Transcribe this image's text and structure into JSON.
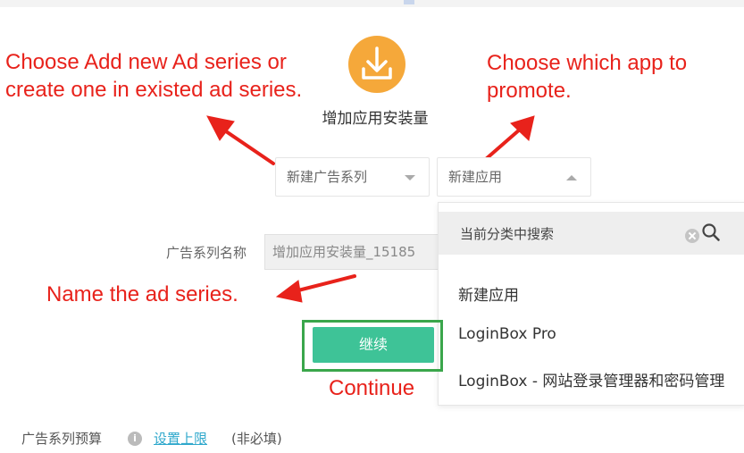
{
  "header": {
    "goal_title": "增加应用安装量",
    "icon": "download-icon",
    "icon_color": "#f5a83a"
  },
  "ad_series_select": {
    "value": "新建广告系列",
    "caret": "chevron-down-icon"
  },
  "app_select": {
    "value": "新建应用",
    "caret": "chevron-up-icon",
    "dropdown": {
      "search_placeholder": "当前分类中搜索",
      "options": [
        "新建应用",
        "LoginBox Pro",
        "LoginBox - 网站登录管理器和密码管理"
      ]
    }
  },
  "ad_series_name": {
    "label": "广告系列名称",
    "value": "增加应用安装量_15185"
  },
  "continue_label": "继续",
  "budget": {
    "label": "广告系列预算",
    "link": "设置上限",
    "note": "(非必填)"
  },
  "annotations": {
    "choose_series": [
      "Choose Add new Ad series or",
      "create one in existed ad series."
    ],
    "choose_app": [
      "Choose which app to",
      "promote."
    ],
    "name_series": "Name the ad series.",
    "continue": "Continue",
    "color": "#e8221b"
  },
  "colors": {
    "accent_green": "#3ec397",
    "highlight_box": "#3aa64b",
    "link_blue": "#2fa8cc"
  }
}
